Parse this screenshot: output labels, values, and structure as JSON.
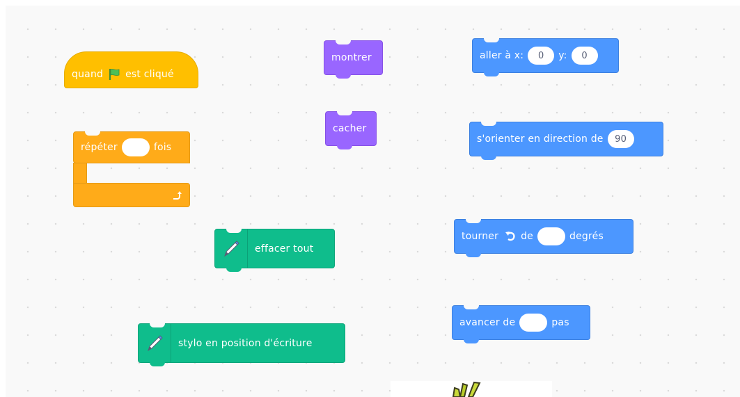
{
  "blocks": {
    "when_flag": {
      "before": "quand",
      "after": "est cliqué",
      "icon": "green-flag-icon"
    },
    "repeat": {
      "before": "répéter",
      "after": "fois",
      "value": "",
      "arrow_icon": "repeat-arrow-icon"
    },
    "show": {
      "label": "montrer"
    },
    "hide": {
      "label": "cacher"
    },
    "goto": {
      "label_x": "aller à x:",
      "x": "0",
      "label_y": "y:",
      "y": "0"
    },
    "point_direction": {
      "label": "s'orienter en direction de",
      "value": "90"
    },
    "turn": {
      "before": "tourner",
      "middle": "de",
      "after": "degrés",
      "value": "",
      "icon": "rotate-left-icon"
    },
    "move": {
      "before": "avancer de",
      "after": "pas",
      "value": ""
    },
    "erase_all": {
      "label": "effacer tout",
      "icon": "pen-icon"
    },
    "pen_down": {
      "label": "stylo en position d'écriture",
      "icon": "pen-icon"
    }
  },
  "colors": {
    "motion": "#4c97ff",
    "looks": "#9966ff",
    "control": "#ffab19",
    "events": "#ffbf00",
    "pen": "#0fbd8c"
  }
}
